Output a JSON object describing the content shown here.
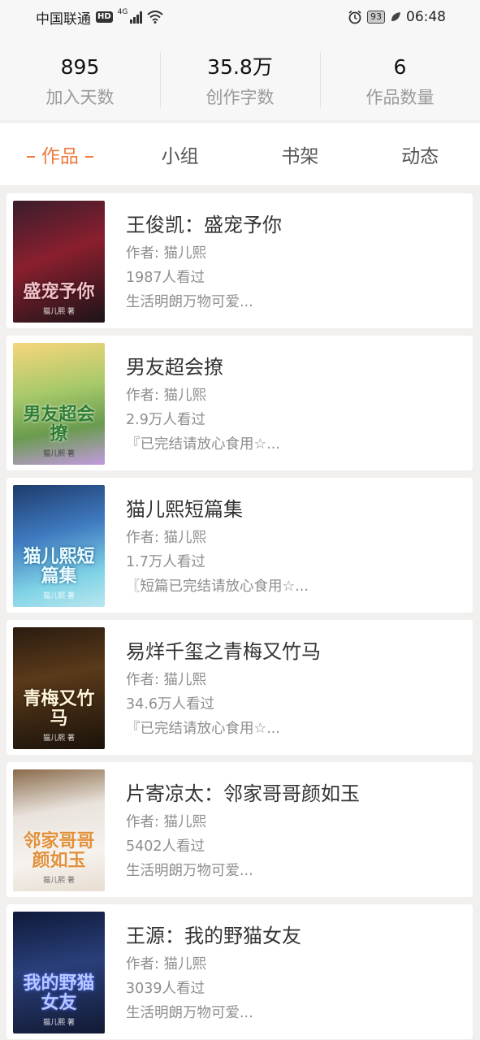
{
  "status_bar": {
    "carrier": "中国联通",
    "hd": "HD",
    "network": "4G",
    "battery": "93",
    "time": "06:48"
  },
  "stats": [
    {
      "value": "895",
      "label": "加入天数"
    },
    {
      "value": "35.8万",
      "label": "创作字数"
    },
    {
      "value": "6",
      "label": "作品数量"
    }
  ],
  "tabs": [
    {
      "label": "作品",
      "active": true
    },
    {
      "label": "小组"
    },
    {
      "label": "书架"
    },
    {
      "label": "动态"
    }
  ],
  "works": [
    {
      "title": "王俊凯：盛宠予你",
      "author": "作者: 猫儿熙",
      "views": "1987人看过",
      "desc": "生活明朗万物可爱...",
      "cover_text": "盛宠予你",
      "cover_author": "猫儿熙 著"
    },
    {
      "title": "男友超会撩",
      "author": "作者: 猫儿熙",
      "views": "2.9万人看过",
      "desc": "『已完结请放心食用☆...",
      "cover_text": "男友超会撩",
      "cover_author": "猫儿熙 著"
    },
    {
      "title": "猫儿熙短篇集",
      "author": "作者: 猫儿熙",
      "views": "1.7万人看过",
      "desc": "〖短篇已完结请放心食用☆...",
      "cover_text": "猫儿熙短篇集",
      "cover_author": "猫儿熙 著"
    },
    {
      "title": "易烊千玺之青梅又竹马",
      "author": "作者: 猫儿熙",
      "views": "34.6万人看过",
      "desc": "『已完结请放心食用☆...",
      "cover_text": "青梅又竹马",
      "cover_author": "猫儿熙 著"
    },
    {
      "title": "片寄凉太：邻家哥哥颜如玉",
      "author": "作者: 猫儿熙",
      "views": "5402人看过",
      "desc": "生活明朗万物可爱...",
      "cover_text": "邻家哥哥颜如玉",
      "cover_author": "猫儿熙 著"
    },
    {
      "title": "王源：我的野猫女友",
      "author": "作者: 猫儿熙",
      "views": "3039人看过",
      "desc": "生活明朗万物可爱...",
      "cover_text": "我的野猫女友",
      "cover_author": "猫儿熙 著"
    }
  ],
  "colors": {
    "accent": "#ee7a3c"
  }
}
